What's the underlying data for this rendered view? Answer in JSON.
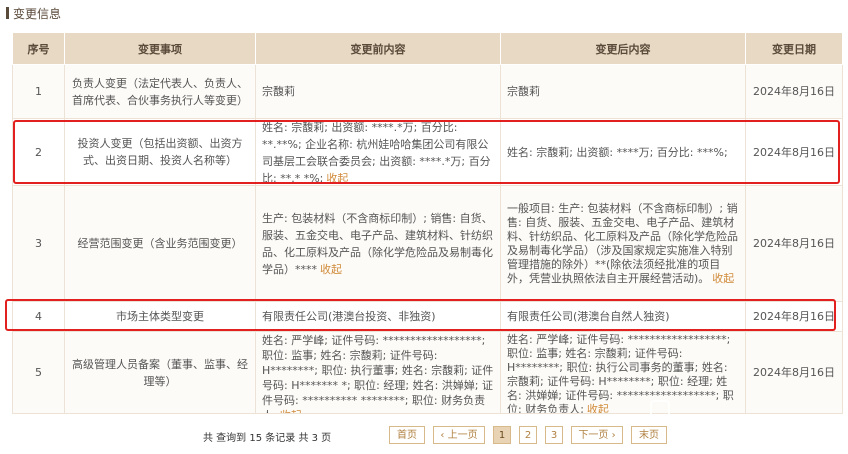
{
  "section": {
    "title": "变更信息"
  },
  "table": {
    "headers": [
      "序号",
      "变更事项",
      "变更前内容",
      "变更后内容",
      "变更日期"
    ],
    "rows": [
      {
        "index": "1",
        "item": "负责人变更（法定代表人、负责人、首席代表、合伙事务执行人等变更）",
        "before": "宗馥莉",
        "after": "宗馥莉",
        "date": "2024年8月16日"
      },
      {
        "index": "2",
        "item": "投资人变更（包括出资额、出资方式、出资日期、投资人名称等）",
        "before": "姓名: 宗馥莉; 出资额: ****.*万; 百分比: **.**%; 企业名称: 杭州娃哈哈集团公司有限公司基层工会联合委员会; 出资额: ****.*万; 百分比: **.* *%;",
        "before_collapse": "收起",
        "after": "姓名: 宗馥莉; 出资额: ****万; 百分比: ***%;",
        "date": "2024年8月16日"
      },
      {
        "index": "3",
        "item": "经营范围变更（含业务范围变更）",
        "before": "生产: 包装材料（不含商标印制）; 销售: 自货、服装、五金交电、电子产品、建筑材料、针纺织品、化工原料及产品（除化学危险品及易制毒化学品）****",
        "before_collapse": "收起",
        "after": "一般项目: 生产: 包装材料（不含商标印制）; 销售: 自货、服装、五金交电、电子产品、建筑材料、针纺织品、化工原料及产品（除化学危险品及易制毒化学品）（涉及国家规定实施准入特别管理措施的除外）**(除依法须经批准的项目外，凭营业执照依法自主开展经营活动)。",
        "after_collapse": "收起",
        "date": "2024年8月16日"
      },
      {
        "index": "4",
        "item": "市场主体类型变更",
        "before": "有限责任公司(港澳台投资、非独资)",
        "after": "有限责任公司(港澳台自然人独资)",
        "date": "2024年8月16日"
      },
      {
        "index": "5",
        "item": "高级管理人员备案（董事、监事、经理等）",
        "before": "姓名: 严学峰; 证件号码: ******************; 职位: 监事; 姓名: 宗馥莉; 证件号码: H********; 职位: 执行董事; 姓名: 宗馥莉; 证件号码: H******* *; 职位: 经理; 姓名: 洪婵婵; 证件号码: ********** ********; 职位: 财务负责人;",
        "before_collapse": "收起",
        "after": "姓名: 严学峰; 证件号码: ******************; 职位: 监事; 姓名: 宗馥莉; 证件号码: H********; 职位: 执行公司事务的董事; 姓名: 宗馥莉; 证件号码: H********; 职位: 经理; 姓名: 洪婵婵; 证件号码: ******************; 职位: 财务负责人;",
        "after_collapse": "收起",
        "date": "2024年8月16日"
      }
    ]
  },
  "pagination": {
    "summary": "共 查询到 15 条记录 共 3 页",
    "first": "首页",
    "prev": "‹ 上一页",
    "pages": [
      "1",
      "2",
      "3"
    ],
    "current": "1",
    "next": "下一页 ›",
    "last": "末页"
  },
  "colors": {
    "header_bg": "#e8d9c4",
    "highlight": "#e32020",
    "accent": "#d08b3a"
  }
}
